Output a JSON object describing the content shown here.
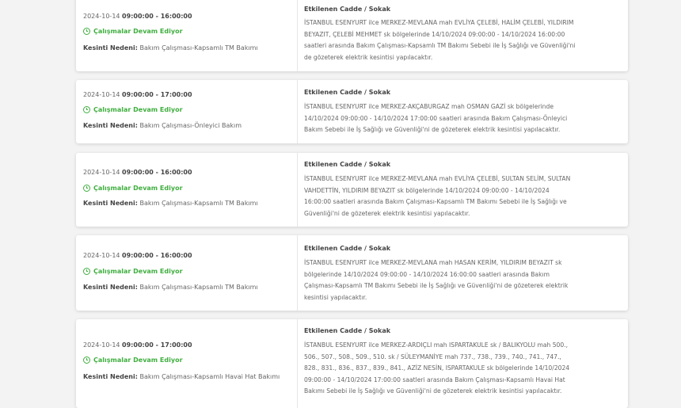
{
  "common": {
    "status_text": "Çalışmalar Devam Ediyor",
    "reason_label": "Kesinti Nedeni:",
    "street_title": "Etkilenen Cadde / Sokak"
  },
  "items": [
    {
      "date": "2024-10-14",
      "time_range": "09:00:00 - 16:00:00",
      "reason": "Bakım Çalışması-Kapsamlı TM Bakımı",
      "description": "İSTANBUL ESENYURT ilce MERKEZ-MEVLANA mah EVLİYA ÇELEBİ, HALİM ÇELEBİ, YILDIRIM BEYAZIT, ÇELEBİ MEHMET sk bölgelerinde 14/10/2024 09:00:00 - 14/10/2024 16:00:00 saatleri arasında Bakım Çalışması-Kapsamlı TM Bakımı Sebebi ile İş Sağlığı ve Güvenliği'ni de gözeterek elektrik kesintisi yapılacaktır."
    },
    {
      "date": "2024-10-14",
      "time_range": "09:00:00 - 17:00:00",
      "reason": "Bakım Çalışması-Önleyici Bakım",
      "description": "İSTANBUL ESENYURT ilce MERKEZ-AKÇABURGAZ mah OSMAN GAZİ sk bölgelerinde 14/10/2024 09:00:00 - 14/10/2024 17:00:00 saatleri arasında Bakım Çalışması-Önleyici Bakım Sebebi ile İş Sağlığı ve Güvenliği'ni de gözeterek elektrik kesintisi yapılacaktır."
    },
    {
      "date": "2024-10-14",
      "time_range": "09:00:00 - 16:00:00",
      "reason": "Bakım Çalışması-Kapsamlı TM Bakımı",
      "description": "İSTANBUL ESENYURT ilce MERKEZ-MEVLANA mah EVLİYA ÇELEBİ, SULTAN SELİM, SULTAN VAHDETTİN, YILDIRIM BEYAZIT sk bölgelerinde 14/10/2024 09:00:00 - 14/10/2024 16:00:00 saatleri arasında Bakım Çalışması-Kapsamlı TM Bakımı Sebebi ile İş Sağlığı ve Güvenliği'ni de gözeterek elektrik kesintisi yapılacaktır."
    },
    {
      "date": "2024-10-14",
      "time_range": "09:00:00 - 16:00:00",
      "reason": "Bakım Çalışması-Kapsamlı TM Bakımı",
      "description": "İSTANBUL ESENYURT ilce MERKEZ-MEVLANA mah HASAN KERİM, YILDIRIM BEYAZIT sk bölgelerinde 14/10/2024 09:00:00 - 14/10/2024 16:00:00 saatleri arasında Bakım Çalışması-Kapsamlı TM Bakımı Sebebi ile İş Sağlığı ve Güvenliği'ni de gözeterek elektrik kesintisi yapılacaktır."
    },
    {
      "date": "2024-10-14",
      "time_range": "09:00:00 - 17:00:00",
      "reason": "Bakım Çalışması-Kapsamlı Havai Hat Bakımı",
      "description": "İSTANBUL ESENYURT ilce MERKEZ-ARDIÇLI mah ISPARTAKULE sk / BALIKYOLU mah 500., 506., 507., 508., 509., 510. sk / SÜLEYMANİYE mah 737., 738., 739., 740., 741., 747., 828., 831., 836., 837., 839., 841., AZİZ NESİN, ISPARTAKULE sk bölgelerinde 14/10/2024 09:00:00 - 14/10/2024 17:00:00 saatleri arasında Bakım Çalışması-Kapsamlı Havai Hat Bakımı Sebebi ile İş Sağlığı ve Güvenliği'ni de gözeterek elektrik kesintisi yapılacaktır."
    }
  ]
}
